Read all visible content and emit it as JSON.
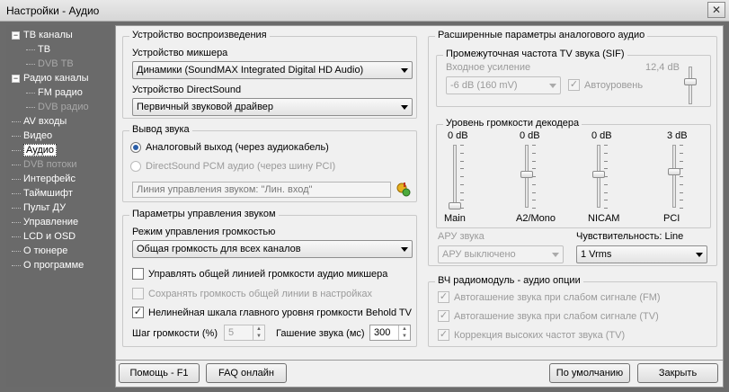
{
  "window": {
    "title": "Настройки - Аудио",
    "close_label": "✕"
  },
  "sidebar": [
    {
      "label": "ТВ каналы",
      "kind": "expander",
      "expander": "−",
      "state": "normal"
    },
    {
      "label": "ТВ",
      "kind": "child",
      "state": "normal"
    },
    {
      "label": "DVB ТВ",
      "kind": "child",
      "state": "disabled"
    },
    {
      "label": "Радио каналы",
      "kind": "expander",
      "expander": "−",
      "state": "normal"
    },
    {
      "label": "FM радио",
      "kind": "child",
      "state": "normal"
    },
    {
      "label": "DVB радио",
      "kind": "child",
      "state": "disabled"
    },
    {
      "label": "AV входы",
      "kind": "top",
      "state": "normal"
    },
    {
      "label": "Видео",
      "kind": "top",
      "state": "normal"
    },
    {
      "label": "Аудио",
      "kind": "top",
      "state": "selected"
    },
    {
      "label": "DVB потоки",
      "kind": "top",
      "state": "disabled"
    },
    {
      "label": "Интерфейс",
      "kind": "top",
      "state": "normal"
    },
    {
      "label": "Таймшифт",
      "kind": "top",
      "state": "normal"
    },
    {
      "label": "Пульт ДУ",
      "kind": "top",
      "state": "normal"
    },
    {
      "label": "Управление",
      "kind": "top",
      "state": "normal"
    },
    {
      "label": "LCD и OSD",
      "kind": "top",
      "state": "normal"
    },
    {
      "label": "О тюнере",
      "kind": "top",
      "state": "normal"
    },
    {
      "label": "О программе",
      "kind": "top",
      "state": "normal"
    }
  ],
  "playback": {
    "title": "Устройство воспроизведения",
    "mixer_label": "Устройство микшера",
    "mixer_value": "Динамики (SoundMAX Integrated Digital HD Audio)",
    "ds_label": "Устройство DirectSound",
    "ds_value": "Первичный звуковой драйвер"
  },
  "output": {
    "title": "Вывод звука",
    "analog_label": "Аналоговый выход (через аудиокабель)",
    "pcm_label": "DirectSound PCM аудио (через шину PCI)",
    "line_value": "Линия управления звуком: \"Лин. вход\""
  },
  "volume": {
    "title": "Параметры управления звуком",
    "mode_label": "Режим управления громкостью",
    "mode_value": "Общая громкость для всех каналов",
    "mixer_line_label": "Управлять общей линией громкости аудио микшера",
    "save_line_label": "Сохранять громкость общей линии в настройках",
    "nonlinear_label": "Нелинейная шкала главного уровня громкости Behold TV",
    "step_label": "Шаг громкости (%)",
    "step_value": "5",
    "mute_label": "Гашение звука (мс)",
    "mute_value": "300",
    "mixer_line_checked": false,
    "save_line_checked": false,
    "nonlinear_checked": true
  },
  "advanced": {
    "title": "Расширенные параметры аналогового аудио",
    "sif_title": "Промежуточная частота TV звука (SIF)",
    "input_gain_label": "Входное усиление",
    "input_gain_db": "12,4 dB",
    "input_gain_value": "-6 dB (160 mV)",
    "auto_level_label": "Автоуровень",
    "auto_level_checked": true,
    "decoder_title": "Уровень громкости декодера",
    "channels": [
      {
        "db": "0 dB",
        "name": "Main",
        "level": 0.0
      },
      {
        "db": "0 dB",
        "name": "A2/Mono",
        "level": 0.5
      },
      {
        "db": "0 dB",
        "name": "NICAM",
        "level": 0.5
      },
      {
        "db": "3 dB",
        "name": "PCI",
        "level": 0.55
      }
    ],
    "agc_label": "АРУ звука",
    "agc_value": "АРУ выключено",
    "sens_label": "Чувствительность: Line",
    "sens_value": "1 Vrms"
  },
  "rf": {
    "title": "ВЧ радиомодуль - аудио опции",
    "fm_label": "Автогашение звука при слабом сигнале (FM)",
    "tv_label": "Автогашение звука при слабом сигнале (TV)",
    "hf_label": "Коррекция высоких частот звука (TV)"
  },
  "footer": {
    "help_label": "Помощь - F1",
    "faq_label": "FAQ онлайн",
    "default_label": "По умолчанию",
    "close_label": "Закрыть"
  },
  "icons": {
    "check": "✓",
    "spin_up": "▲",
    "spin_down": "▼"
  },
  "colors": {
    "accent": "#2a5ea8",
    "sidebar_bg": "#6a6a6a",
    "panel_bg": "#f0f0f0"
  }
}
